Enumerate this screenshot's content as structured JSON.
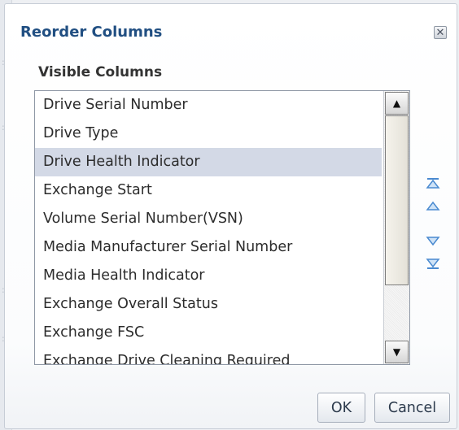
{
  "dialog": {
    "title": "Reorder Columns",
    "close_icon": "close-icon"
  },
  "visible_columns": {
    "label": "Visible Columns",
    "selected_index": 2,
    "items": [
      "Drive Serial Number",
      "Drive Type",
      "Drive Health Indicator",
      "Exchange Start",
      "Volume Serial Number(VSN)",
      "Media Manufacturer Serial Number",
      "Media Health Indicator",
      "Exchange Overall Status",
      "Exchange FSC",
      "Exchange Drive Cleaning Required"
    ]
  },
  "reorder_controls": [
    "move-to-top-icon",
    "move-up-icon",
    "move-down-icon",
    "move-to-bottom-icon"
  ],
  "buttons": {
    "ok_label": "OK",
    "cancel_label": "Cancel"
  },
  "colors": {
    "title": "#214f82",
    "selection": "#d3d9e6",
    "reorder_arrows": "#4a8ad0"
  }
}
